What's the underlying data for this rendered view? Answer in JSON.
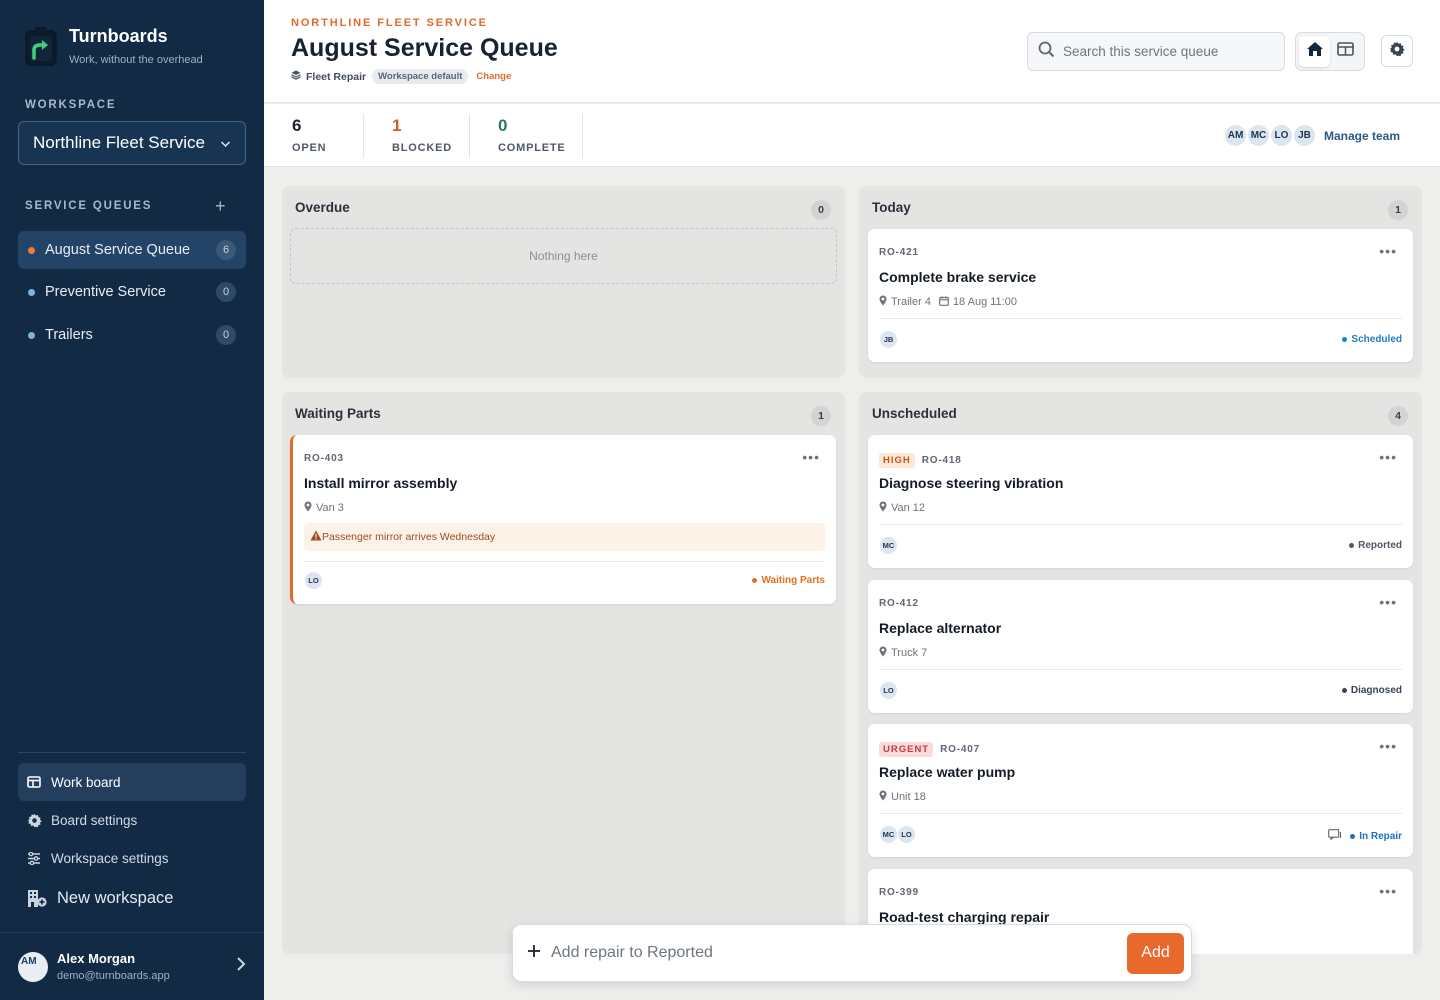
{
  "brand": {
    "name": "Turnboards",
    "tagline": "Work, without the overhead"
  },
  "sidebar": {
    "workspace_label": "WORKSPACE",
    "workspace_selected": "Northline Fleet Service",
    "queues_label": "SERVICE QUEUES",
    "add_queue": "+",
    "queues": [
      {
        "label": "August Service Queue",
        "count": "6",
        "dot": "#f07a3c",
        "active": true
      },
      {
        "label": "Preventive Service",
        "count": "0",
        "dot": "#7fb3e0",
        "active": false
      },
      {
        "label": "Trailers",
        "count": "0",
        "dot": "#7fb3e0",
        "active": false
      }
    ],
    "nav": [
      {
        "label": "Work board",
        "icon": "board-icon"
      },
      {
        "label": "Board settings",
        "icon": "gear-icon"
      },
      {
        "label": "Workspace settings",
        "icon": "sliders-icon"
      },
      {
        "label": "New workspace",
        "icon": "building-plus-icon"
      }
    ],
    "user": {
      "initials": "AM",
      "name": "Alex Morgan",
      "email": "demo@turnboards.app"
    }
  },
  "header": {
    "eyebrow": "NORTHLINE FLEET SERVICE",
    "title": "August Service Queue",
    "team": "Fleet Repair",
    "team_pill": "Workspace default",
    "change": "Change",
    "search_placeholder": "Search this service queue"
  },
  "stats": [
    {
      "value": "6",
      "label": "OPEN",
      "color": "#1b2230"
    },
    {
      "value": "1",
      "label": "BLOCKED",
      "color": "#c8601f"
    },
    {
      "value": "0",
      "label": "COMPLETE",
      "color": "#2d7a55"
    }
  ],
  "team": {
    "members": [
      "AM",
      "MC",
      "LO",
      "JB"
    ],
    "manage": "Manage team"
  },
  "columns": {
    "overdue": {
      "title": "Overdue",
      "count": "0",
      "empty": "Nothing here"
    },
    "today": {
      "title": "Today",
      "count": "1"
    },
    "waiting": {
      "title": "Waiting Parts",
      "count": "1"
    },
    "unscheduled": {
      "title": "Unscheduled",
      "count": "4"
    }
  },
  "cards": {
    "ro421": {
      "id": "RO-421",
      "title": "Complete brake service",
      "location": "Trailer 4",
      "date": "18 Aug 11:00",
      "assignees": [
        "JB"
      ],
      "status": "Scheduled",
      "status_color": "#1f7fc2"
    },
    "ro403": {
      "id": "RO-403",
      "title": "Install mirror assembly",
      "location": "Van 3",
      "warning": "Passenger mirror arrives Wednesday",
      "assignees": [
        "LO"
      ],
      "status": "Waiting Parts",
      "status_color": "#e07020"
    },
    "ro418": {
      "id": "RO-418",
      "priority": "HIGH",
      "title": "Diagnose steering vibration",
      "location": "Van 12",
      "assignees": [
        "MC"
      ],
      "status": "Reported",
      "status_color": "#4e5866"
    },
    "ro412": {
      "id": "RO-412",
      "title": "Replace alternator",
      "location": "Truck 7",
      "assignees": [
        "LO"
      ],
      "status": "Diagnosed",
      "status_color": "#3a4452"
    },
    "ro407": {
      "id": "RO-407",
      "priority": "URGENT",
      "title": "Replace water pump",
      "location": "Unit 18",
      "assignees": [
        "MC",
        "LO"
      ],
      "status": "In Repair",
      "status_color": "#1f6fc2"
    },
    "ro399": {
      "id": "RO-399",
      "title": "Road-test charging repair"
    }
  },
  "addbar": {
    "placeholder": "Add repair to Reported",
    "button": "Add"
  }
}
